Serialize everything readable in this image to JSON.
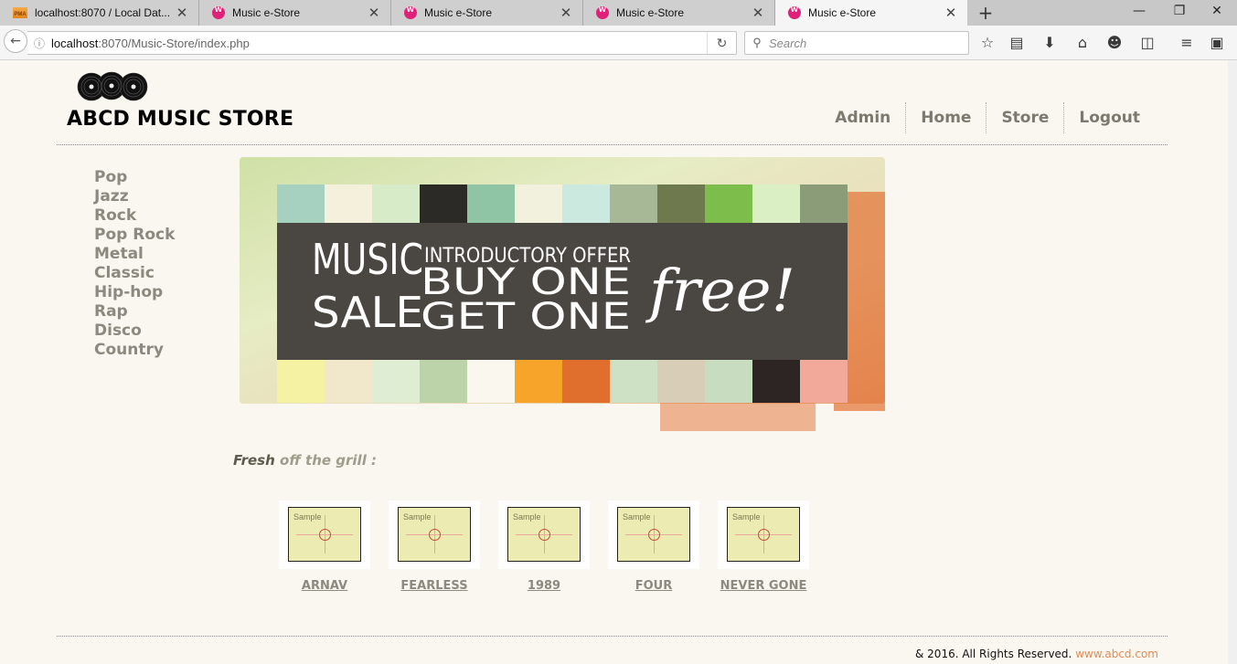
{
  "browser": {
    "tabs": [
      {
        "title": "localhost:8070 / Local Dat...",
        "favicon": "phpmyadmin-icon",
        "active": false
      },
      {
        "title": "Music e-Store",
        "favicon": "store-icon",
        "active": false
      },
      {
        "title": "Music e-Store",
        "favicon": "store-icon",
        "active": false
      },
      {
        "title": "Music e-Store",
        "favicon": "store-icon",
        "active": false
      },
      {
        "title": "Music e-Store",
        "favicon": "store-icon",
        "active": true
      }
    ],
    "url_host": "localhost",
    "url_path": ":8070/Music-Store/index.php",
    "search_placeholder": "Search",
    "pma_badge": "PMA"
  },
  "site": {
    "title": "ABCD MUSIC STORE",
    "nav": [
      "Admin",
      "Home",
      "Store",
      "Logout"
    ],
    "genres": [
      "Pop",
      "Jazz",
      "Rock",
      "Pop Rock",
      "Metal",
      "Classic",
      "Hip-hop",
      "Rap",
      "Disco",
      "Country"
    ],
    "banner": {
      "big_left_1": "MUSIC",
      "big_left_2": "SALE",
      "offer": "INTRODUCTORY OFFER",
      "line1": "BUY ONE",
      "line2": "GET ONE",
      "script": "free!"
    },
    "fresh_bold": "Fresh",
    "fresh_rest": "off the grill :",
    "albums": [
      {
        "name": "ARNAV"
      },
      {
        "name": "FEARLESS"
      },
      {
        "name": "1989"
      },
      {
        "name": "FOUR"
      },
      {
        "name": "NEVER GONE"
      }
    ],
    "thumb_label": "Sample",
    "footer_text": "& 2016. All Rights Reserved.",
    "footer_link": "www.abcd.com"
  },
  "colors": {
    "page_bg": "#f9f7ef",
    "nav_text": "#7a7a6e",
    "footer_link": "#e58b54"
  }
}
